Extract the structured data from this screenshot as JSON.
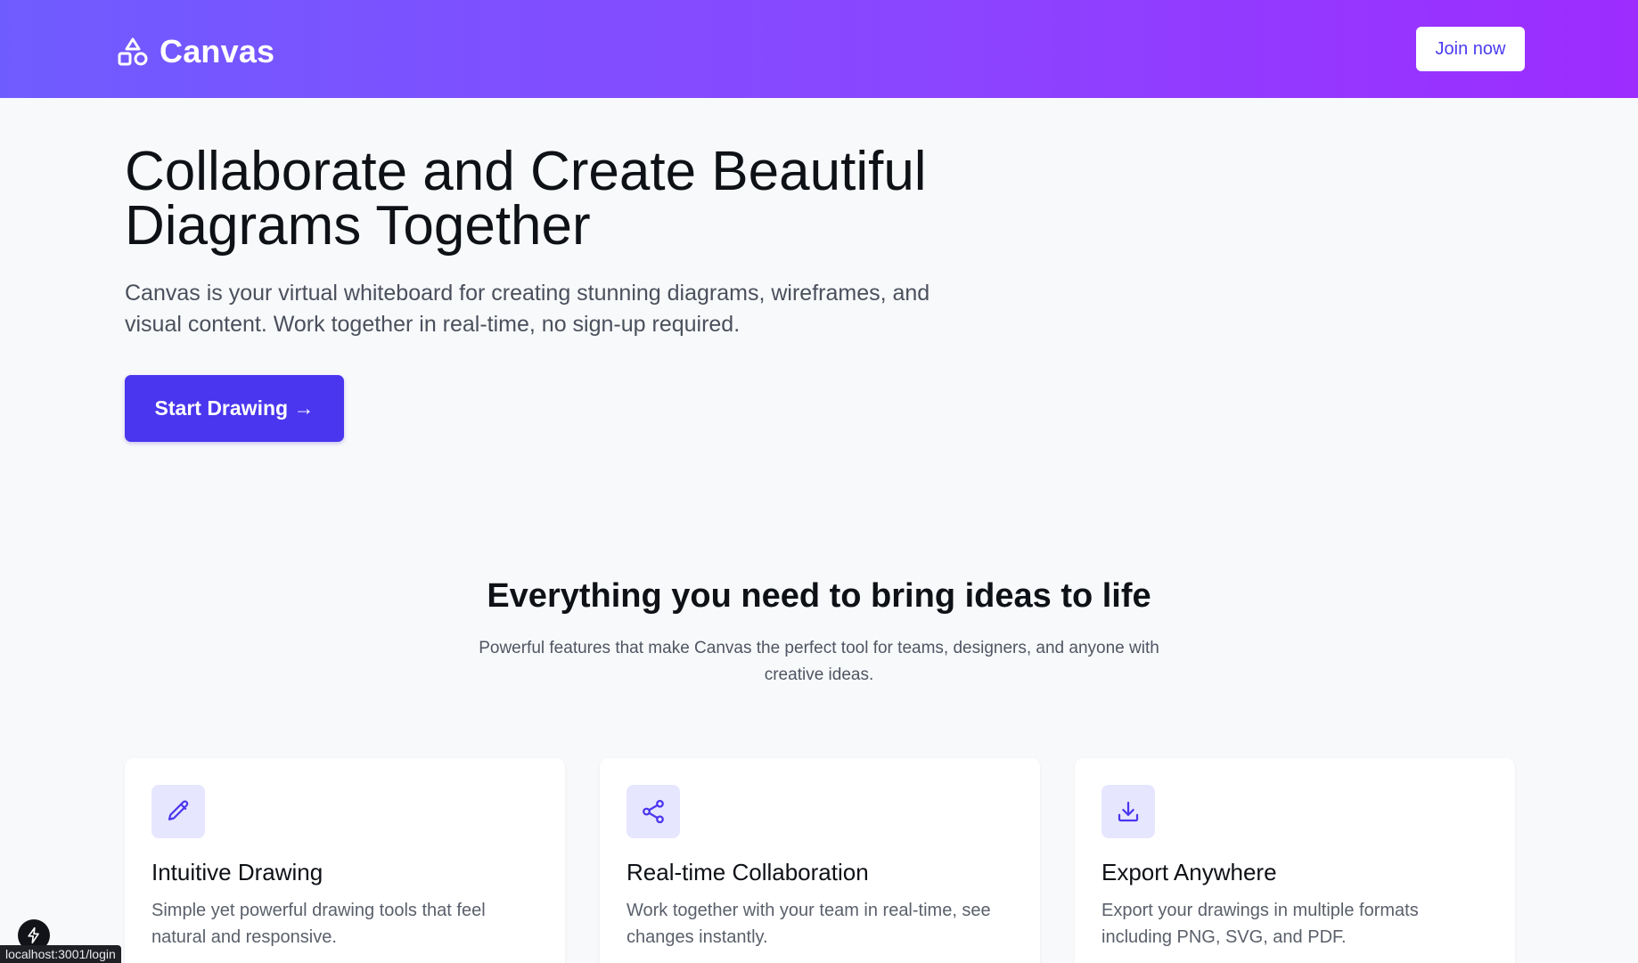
{
  "header": {
    "brand_name": "Canvas",
    "brand_icon": "shapes-icon",
    "join_button_label": "Join now"
  },
  "hero": {
    "title_line1": "Collaborate and Create Beautiful",
    "title_line2": "Diagrams Together",
    "subtitle": "Canvas is your virtual whiteboard for creating stunning diagrams, wireframes, and visual content. Work together in real-time, no sign-up required.",
    "cta_label": "Start Drawing →"
  },
  "features": {
    "title": "Everything you need to bring ideas to life",
    "subtitle": "Powerful features that make Canvas the perfect tool for teams, designers, and anyone with creative ideas.",
    "cards": [
      {
        "icon": "pencil-icon",
        "title": "Intuitive Drawing",
        "text": "Simple yet powerful drawing tools that feel natural and responsive."
      },
      {
        "icon": "share-icon",
        "title": "Real-time Collaboration",
        "text": "Work together with your team in real-time, see changes instantly."
      },
      {
        "icon": "download-icon",
        "title": "Export Anywhere",
        "text": "Export your drawings in multiple formats including PNG, SVG, and PDF."
      }
    ]
  },
  "status_bar": {
    "url": "localhost:3001/login",
    "dev_icon": "lightning-icon"
  },
  "colors": {
    "header_gradient_start": "#6f5cff",
    "header_gradient_end": "#9d2cff",
    "primary_button": "#4a36ee",
    "icon_tile": "#e7e6ff",
    "icon_stroke": "#4a36ee",
    "page_background": "#f8f9fb"
  }
}
